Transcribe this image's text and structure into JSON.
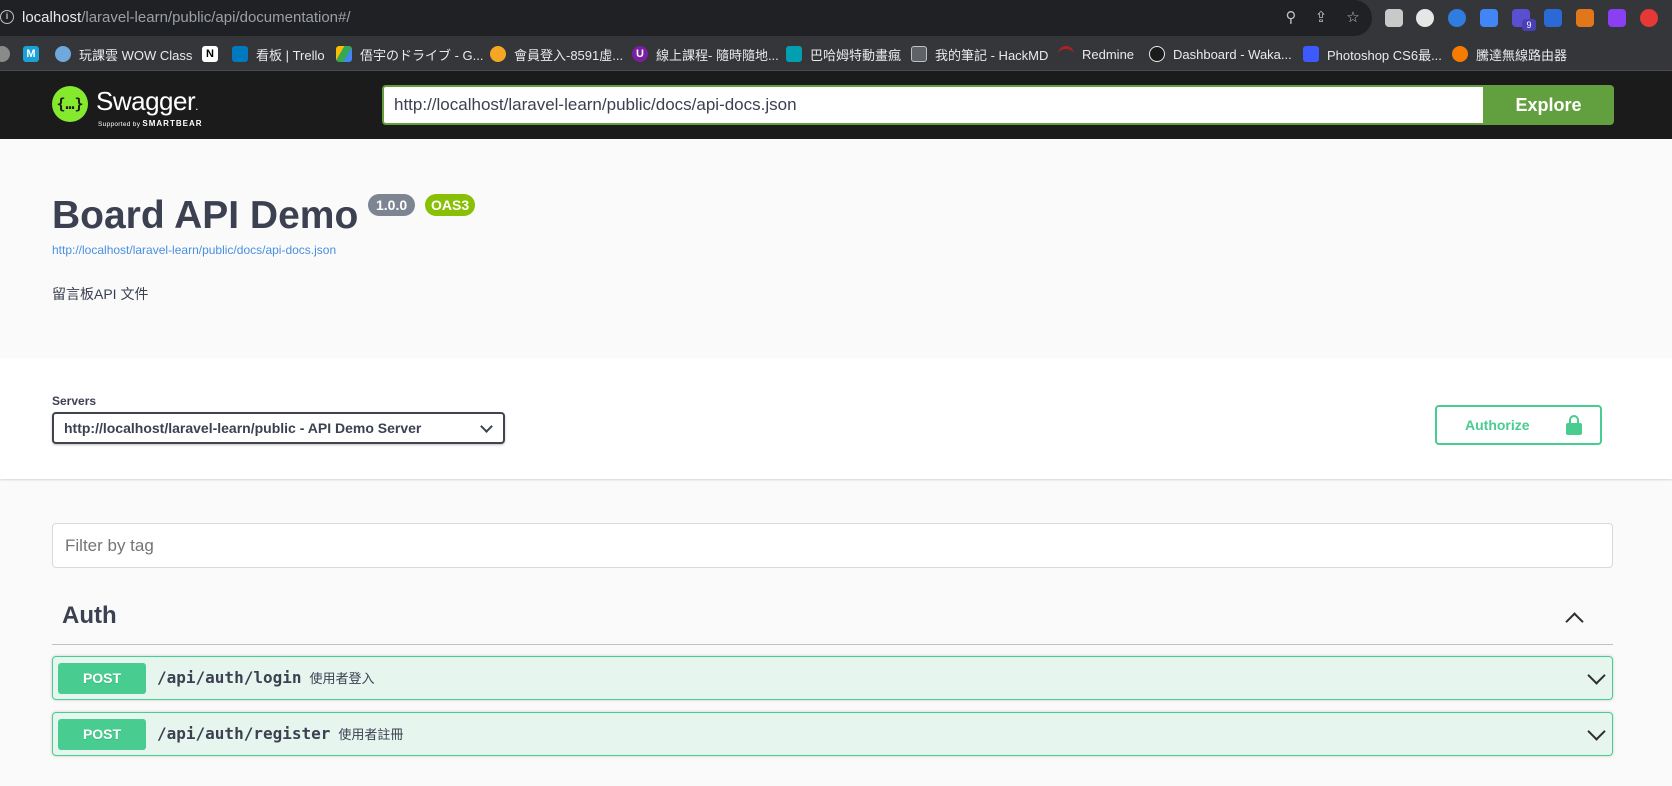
{
  "browser": {
    "url_host": "localhost",
    "url_path": "/laravel-learn/public/api/documentation#/",
    "bookmarks": [
      {
        "label": "",
        "icon": "m-icon"
      },
      {
        "label": "玩課雲 WOW Class",
        "icon": "wowclass-icon"
      },
      {
        "label": "",
        "icon": "notion-icon"
      },
      {
        "label": "看板 | Trello",
        "icon": "trello-icon"
      },
      {
        "label": "俉宇のドライブ - G...",
        "icon": "google-drive-icon"
      },
      {
        "label": "會員登入-8591虛...",
        "icon": "8591-icon"
      },
      {
        "label": "線上課程- 隨時隨地...",
        "icon": "course-icon"
      },
      {
        "label": "巴哈姆特動畫瘋",
        "icon": "bahamut-icon"
      },
      {
        "label": "我的筆記 - HackMD",
        "icon": "hackmd-icon"
      },
      {
        "label": "Redmine",
        "icon": "redmine-icon"
      },
      {
        "label": "Dashboard - Waka...",
        "icon": "wakatime-icon"
      },
      {
        "label": "Photoshop CS6最...",
        "icon": "photoshop-icon"
      },
      {
        "label": "騰達無線路由器",
        "icon": "tenda-icon"
      }
    ],
    "extension_badge": "9"
  },
  "topbar": {
    "logo_symbol": "{…}",
    "logo_text": "Swagger",
    "logo_tm": ".",
    "logo_sub_prefix": "Supported by",
    "logo_sub_brand": "SMARTBEAR",
    "spec_url": "http://localhost/laravel-learn/public/docs/api-docs.json",
    "explore_label": "Explore"
  },
  "info": {
    "title": "Board API Demo",
    "version": "1.0.0",
    "oas": "OAS3",
    "spec_link": "http://localhost/laravel-learn/public/docs/api-docs.json",
    "description": "留言板API 文件"
  },
  "servers": {
    "label": "Servers",
    "selected": "http://localhost/laravel-learn/public - API Demo Server",
    "authorize_label": "Authorize"
  },
  "filter": {
    "placeholder": "Filter by tag"
  },
  "tags": [
    {
      "name": "Auth",
      "operations": [
        {
          "method": "POST",
          "path": "/api/auth/login",
          "summary": "使用者登入"
        },
        {
          "method": "POST",
          "path": "/api/auth/register",
          "summary": "使用者註冊"
        }
      ]
    }
  ],
  "colors": {
    "post": "#49cc90",
    "explore": "#62a03f",
    "logo": "#85ea2d",
    "oas_badge": "#89bf04",
    "version_badge": "#7d8492"
  }
}
